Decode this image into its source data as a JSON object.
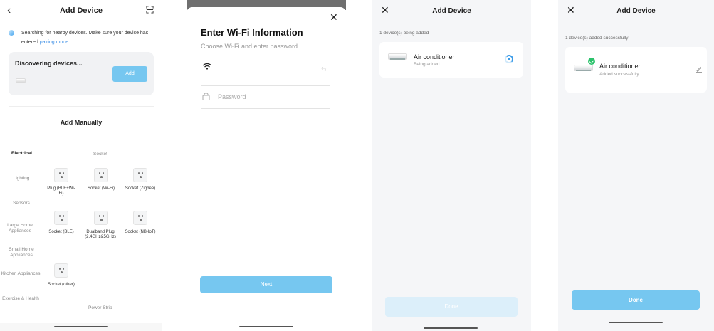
{
  "screen1": {
    "back_icon": "chevron-left-icon",
    "title": "Add Device",
    "scan_icon": "scan-icon",
    "search_text": "Searching for nearby devices. Make sure your device has entered ",
    "pairing_link": "pairing mode",
    "search_period": ".",
    "discovering_title": "Discovering devices...",
    "add_button": "Add",
    "add_manually": "Add Manually",
    "categories": [
      "Electrical",
      "Lighting",
      "Sensors",
      "Large Home Appliances",
      "Small Home Appliances",
      "Kitchen Appliances",
      "Exercise & Health"
    ],
    "section_socket": "Socket",
    "section_power_strip": "Power Strip",
    "devices": [
      {
        "label": "Plug (BLE+Wi-Fi)"
      },
      {
        "label": "Socket (Wi-Fi)"
      },
      {
        "label": "Socket (Zigbee)"
      },
      {
        "label": "Socket (BLE)"
      },
      {
        "label": "Dualband Plug (2.4GHz&5GHz)"
      },
      {
        "label": "Socket (NB-IoT)"
      },
      {
        "label": "Socket (other)"
      }
    ]
  },
  "screen2": {
    "close_icon": "close-icon",
    "title": "Enter Wi-Fi Information",
    "subtitle": "Choose Wi-Fi and enter password",
    "wifi_icon": "wifi-icon",
    "swap_icon": "swap-icon",
    "lock_icon": "lock-icon",
    "password_placeholder": "Password",
    "next_button": "Next"
  },
  "screen3": {
    "close_icon": "close-icon",
    "title": "Add Device",
    "status": "1 device(s) being added",
    "device_name": "Air conditioner",
    "device_state": "Being added",
    "done_button": "Done"
  },
  "screen4": {
    "close_icon": "close-icon",
    "title": "Add Device",
    "status": "1 device(s) added successfully",
    "device_name": "Air conditioner",
    "device_state": "Added successfully",
    "edit_icon": "pencil-icon",
    "done_button": "Done"
  },
  "colors": {
    "accent": "#76c7f0",
    "link": "#3c8fe6",
    "success": "#2bc26b",
    "disabled_button": "#dceffa"
  }
}
